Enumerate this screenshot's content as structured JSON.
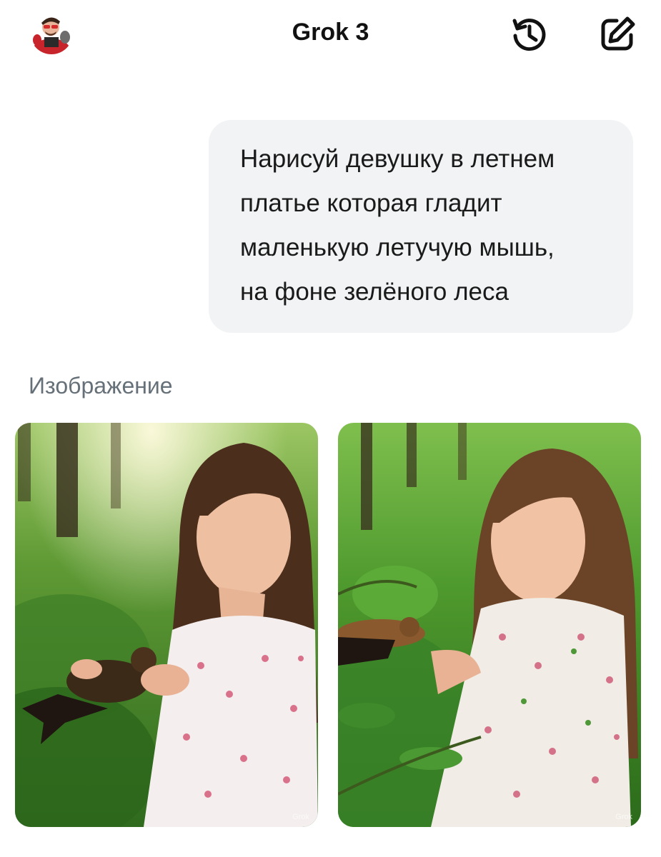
{
  "header": {
    "title": "Grok 3",
    "avatar_icon": "user-avatar-icon",
    "history_icon": "history-icon",
    "new_chat_icon": "new-chat-icon"
  },
  "conversation": {
    "user_message_lines": [
      "Нарисуй девушку в летнем",
      "платье которая гладит",
      "маленькую летучую мышь,",
      "на фоне зелёного леса"
    ]
  },
  "images_section": {
    "label": "Изображение",
    "images": [
      {
        "watermark": "Grok"
      },
      {
        "watermark": "Grok"
      }
    ]
  },
  "colors": {
    "bubble_bg": "#f1f3f4",
    "section_label": "#667078",
    "forest_green": "#4e8a32"
  }
}
